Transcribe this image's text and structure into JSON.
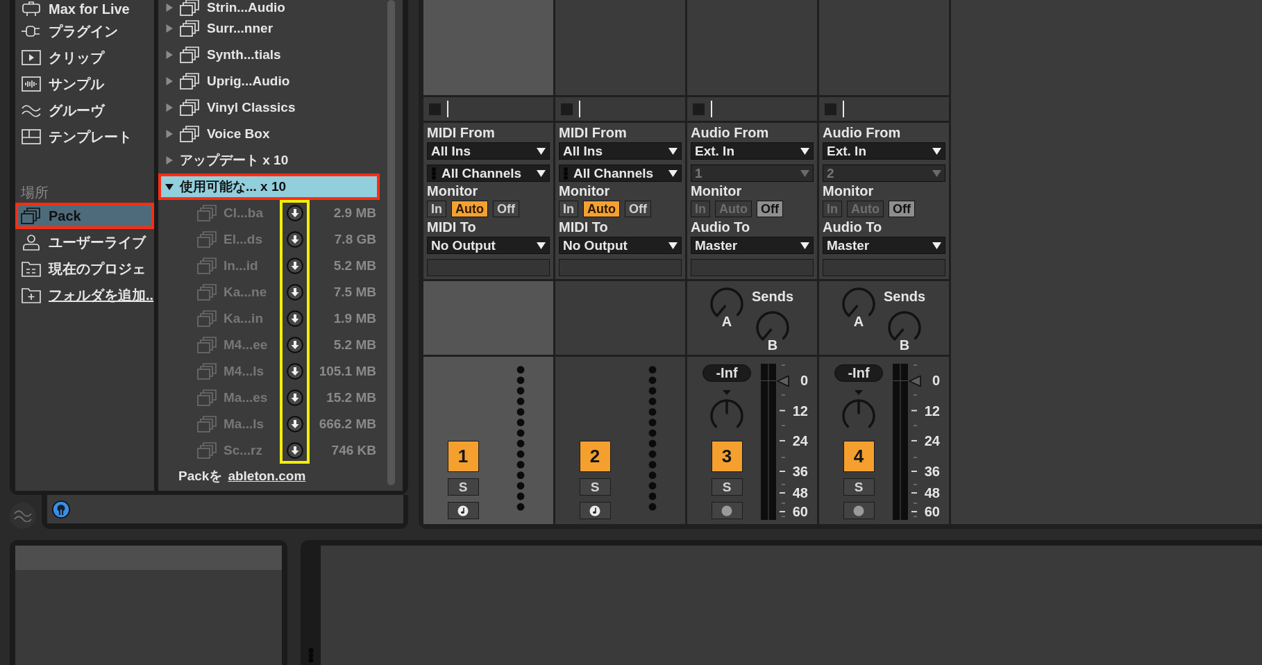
{
  "browser": {
    "categories": [
      {
        "label": "Max for Live",
        "kind": "device",
        "selected": false
      },
      {
        "label": "プラグイン",
        "kind": "plugin",
        "selected": false
      },
      {
        "label": "クリップ",
        "kind": "clip",
        "selected": false
      },
      {
        "label": "サンプル",
        "kind": "sample",
        "selected": false
      },
      {
        "label": "グルーヴ",
        "kind": "groove",
        "selected": false
      },
      {
        "label": "テンプレート",
        "kind": "template",
        "selected": false
      }
    ],
    "places_header": "場所",
    "places": [
      {
        "label": "Pack",
        "kind": "pack",
        "selected": true,
        "highlighted": true
      },
      {
        "label": "ユーザーライブ",
        "kind": "user",
        "selected": false,
        "highlighted": false
      },
      {
        "label": "現在のプロジェ",
        "kind": "project",
        "selected": false,
        "highlighted": false
      },
      {
        "label": "フォルダを追加..",
        "kind": "addfolder",
        "selected": false,
        "highlighted": false
      }
    ],
    "items": [
      {
        "label": "Strin...Audio",
        "kind": "pack",
        "expanded": false,
        "selected": false,
        "highlighted": false
      },
      {
        "label": "Surr...nner",
        "kind": "pack",
        "expanded": false,
        "selected": false,
        "highlighted": false
      },
      {
        "label": "Synth...tials",
        "kind": "pack",
        "expanded": false,
        "selected": false,
        "highlighted": false
      },
      {
        "label": "Uprig...Audio",
        "kind": "pack",
        "expanded": false,
        "selected": false,
        "highlighted": false
      },
      {
        "label": "Vinyl Classics",
        "kind": "pack",
        "expanded": false,
        "selected": false,
        "highlighted": false
      },
      {
        "label": "Voice Box",
        "kind": "pack",
        "expanded": false,
        "selected": false,
        "highlighted": false
      },
      {
        "label": "アップデート x 10",
        "kind": "folder",
        "expanded": false,
        "selected": false,
        "highlighted": false
      },
      {
        "label": "使用可能な... x 10",
        "kind": "folder",
        "expanded": true,
        "selected": true,
        "highlighted": true,
        "downloads_highlighted": true,
        "children": [
          {
            "label": "Cl...ba",
            "size": "2.9 MB",
            "installed": false,
            "selected": false
          },
          {
            "label": "El...ds",
            "size": "7.8 GB",
            "installed": false,
            "selected": false
          },
          {
            "label": "In...id",
            "size": "5.2 MB",
            "installed": false,
            "selected": false
          },
          {
            "label": "Ka...ne",
            "size": "7.5 MB",
            "installed": false,
            "selected": false
          },
          {
            "label": "Ka...in",
            "size": "1.9 MB",
            "installed": false,
            "selected": false
          },
          {
            "label": "M4...ee",
            "size": "5.2 MB",
            "installed": false,
            "selected": false
          },
          {
            "label": "M4...ls",
            "size": "105.1 MB",
            "installed": false,
            "selected": false
          },
          {
            "label": "Ma...es",
            "size": "15.2 MB",
            "installed": false,
            "selected": false
          },
          {
            "label": "Ma...ls",
            "size": "666.2 MB",
            "installed": false,
            "selected": false
          },
          {
            "label": "Sc...rz",
            "size": "746 KB",
            "installed": false,
            "selected": false
          }
        ]
      }
    ],
    "footer": {
      "text": "Packを",
      "link": "ableton.com"
    }
  },
  "mixer": {
    "tracks": [
      {
        "kind": "midi",
        "selected": true,
        "input_label": "MIDI From",
        "input": "All Ins",
        "channel": "All Channels",
        "channel_disabled": false,
        "monitor_label": "Monitor",
        "monitor_dimmed": false,
        "monitor": [
          {
            "label": "In",
            "selected": false
          },
          {
            "label": "Auto",
            "selected": true
          },
          {
            "label": "Off",
            "selected": false
          }
        ],
        "output_label": "MIDI To",
        "output": "No Output",
        "number": "1",
        "active": true,
        "solo": "S"
      },
      {
        "kind": "midi",
        "selected": false,
        "input_label": "MIDI From",
        "input": "All Ins",
        "channel": "All Channels",
        "channel_disabled": false,
        "monitor_label": "Monitor",
        "monitor_dimmed": false,
        "monitor": [
          {
            "label": "In",
            "selected": false
          },
          {
            "label": "Auto",
            "selected": true
          },
          {
            "label": "Off",
            "selected": false
          }
        ],
        "output_label": "MIDI To",
        "output": "No Output",
        "number": "2",
        "active": true,
        "solo": "S"
      },
      {
        "kind": "audio",
        "selected": false,
        "input_label": "Audio From",
        "input": "Ext. In",
        "channel": "1",
        "channel_disabled": true,
        "monitor_label": "Monitor",
        "monitor_dimmed": true,
        "monitor": [
          {
            "label": "In",
            "selected": false
          },
          {
            "label": "Auto",
            "selected": false
          },
          {
            "label": "Off",
            "selected": true
          }
        ],
        "output_label": "Audio To",
        "output": "Master",
        "sends_label": "Sends",
        "sends": [
          {
            "label": "A"
          },
          {
            "label": "B"
          }
        ],
        "volume": "-Inf",
        "fader": {
          "level": 0.89
        },
        "scale": [
          "0",
          "12",
          "24",
          "36",
          "48",
          "60"
        ],
        "number": "3",
        "active": true,
        "solo": "S"
      },
      {
        "kind": "audio",
        "selected": false,
        "input_label": "Audio From",
        "input": "Ext. In",
        "channel": "2",
        "channel_disabled": true,
        "monitor_label": "Monitor",
        "monitor_dimmed": true,
        "monitor": [
          {
            "label": "In",
            "selected": false
          },
          {
            "label": "Auto",
            "selected": false
          },
          {
            "label": "Off",
            "selected": true
          }
        ],
        "output_label": "Audio To",
        "output": "Master",
        "sends_label": "Sends",
        "sends": [
          {
            "label": "A"
          },
          {
            "label": "B"
          }
        ],
        "volume": "-Inf",
        "fader": {
          "level": 0.89
        },
        "scale": [
          "0",
          "12",
          "24",
          "36",
          "48",
          "60"
        ],
        "number": "4",
        "active": true,
        "solo": "S"
      }
    ]
  }
}
